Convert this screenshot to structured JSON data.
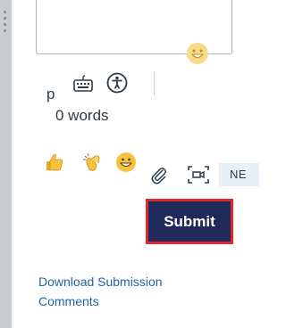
{
  "editor": {
    "paragraph_indicator": "p",
    "word_count": "0 words"
  },
  "icons": {
    "keyboard": "keyboard-icon",
    "accessibility": "accessibility-icon",
    "attach": "paperclip-icon",
    "media": "media-record-icon",
    "emoji": "smiley-emoji-icon",
    "thumbs": "thumbs-up-emoji",
    "clap": "clapping-hands-emoji",
    "grin": "grinning-face-emoji"
  },
  "badge": {
    "label": "NE"
  },
  "actions": {
    "submit_label": "Submit"
  },
  "links": {
    "download_comments": "Download Submission Comments"
  },
  "colors": {
    "submit_bg": "#1f2a5a",
    "submit_border": "#e0262e",
    "link": "#2164a5",
    "rail": "#c7cdd1",
    "badge_bg": "#e7f0f8",
    "emoji_yellow": "#f7c23e"
  }
}
